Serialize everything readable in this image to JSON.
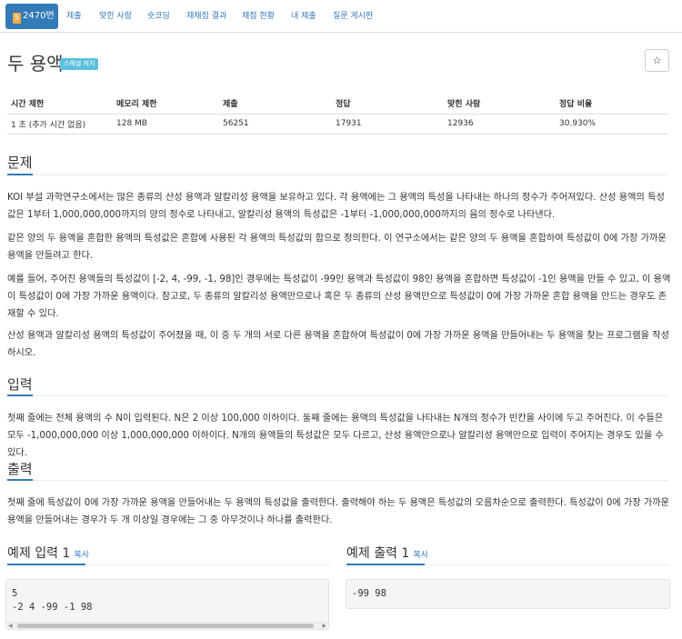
{
  "nav": {
    "active_tier": "5",
    "active_label": "2470번",
    "items": [
      "제출",
      "맞힌 사람",
      "숏코딩",
      "재채점 결과",
      "채점 현황",
      "내 제출",
      "질문 게시판"
    ]
  },
  "problem": {
    "title": "두 용액",
    "badge": "스페셜 저지",
    "star": "☆"
  },
  "info": {
    "headers": [
      "시간 제한",
      "메모리 제한",
      "제출",
      "정답",
      "맞힌 사람",
      "정답 비율"
    ],
    "values": [
      "1 초 (추가 시간 없음)",
      "128 MB",
      "56251",
      "17931",
      "12936",
      "30.930%"
    ]
  },
  "sections": {
    "problem_heading": "문제",
    "problem_paragraphs": [
      "KOI 부설 과학연구소에서는 많은 종류의 산성 용액과 알칼리성 용액을 보유하고 있다. 각 용액에는 그 용액의 특성을 나타내는 하나의 정수가 주어져있다. 산성 용액의 특성값은 1부터 1,000,000,000까지의 양의 정수로 나타내고, 알칼리성 용액의 특성값은 -1부터 -1,000,000,000까지의 음의 정수로 나타낸다.",
      "같은 양의 두 용액을 혼합한 용액의 특성값은 혼합에 사용된 각 용액의 특성값의 합으로 정의한다. 이 연구소에서는 같은 양의 두 용액을 혼합하여 특성값이 0에 가장 가까운 용액을 만들려고 한다.",
      "예를 들어, 주어진 용액들의 특성값이 [-2, 4, -99, -1, 98]인 경우에는 특성값이 -99인 용액과 특성값이 98인 용액을 혼합하면 특성값이 -1인 용액을 만들 수 있고, 이 용액이 특성값이 0에 가장 가까운 용액이다. 참고로, 두 종류의 알칼리성 용액만으로나 혹은 두 종류의 산성 용액만으로 특성값이 0에 가장 가까운 혼합 용액을 만드는 경우도 존재할 수 있다.",
      "산성 용액과 알칼리성 용액의 특성값이 주어졌을 때, 이 중 두 개의 서로 다른 용액을 혼합하여 특성값이 0에 가장 가까운 용액을 만들어내는 두 용액을 찾는 프로그램을 작성하시오."
    ],
    "input_heading": "입력",
    "input_text": "첫째 줄에는 전체 용액의 수 N이 입력된다. N은 2 이상 100,000 이하이다. 둘째 줄에는 용액의 특성값을 나타내는 N개의 정수가 빈칸을 사이에 두고 주어진다. 이 수들은 모두 -1,000,000,000 이상 1,000,000,000 이하이다. N개의 용액들의 특성값은 모두 다르고, 산성 용액만으로나 알칼리성 용액만으로 입력이 주어지는 경우도 있을 수 있다.",
    "output_heading": "출력",
    "output_text": "첫째 줄에 특성값이 0에 가장 가까운 용액을 만들어내는 두 용액의 특성값을 출력한다. 출력해야 하는 두 용액은 특성값의 오름차순으로 출력한다. 특성값이 0에 가장 가까운 용액을 만들어내는 경우가 두 개 이상일 경우에는 그 중 아무것이나 하나를 출력한다."
  },
  "samples": {
    "input_heading": "예제 입력 1",
    "output_heading": "예제 출력 1",
    "copy_label": "복사",
    "input_lines": [
      "5",
      "-2 4 -99 -1 98"
    ],
    "output_lines": [
      "-99 98"
    ]
  }
}
